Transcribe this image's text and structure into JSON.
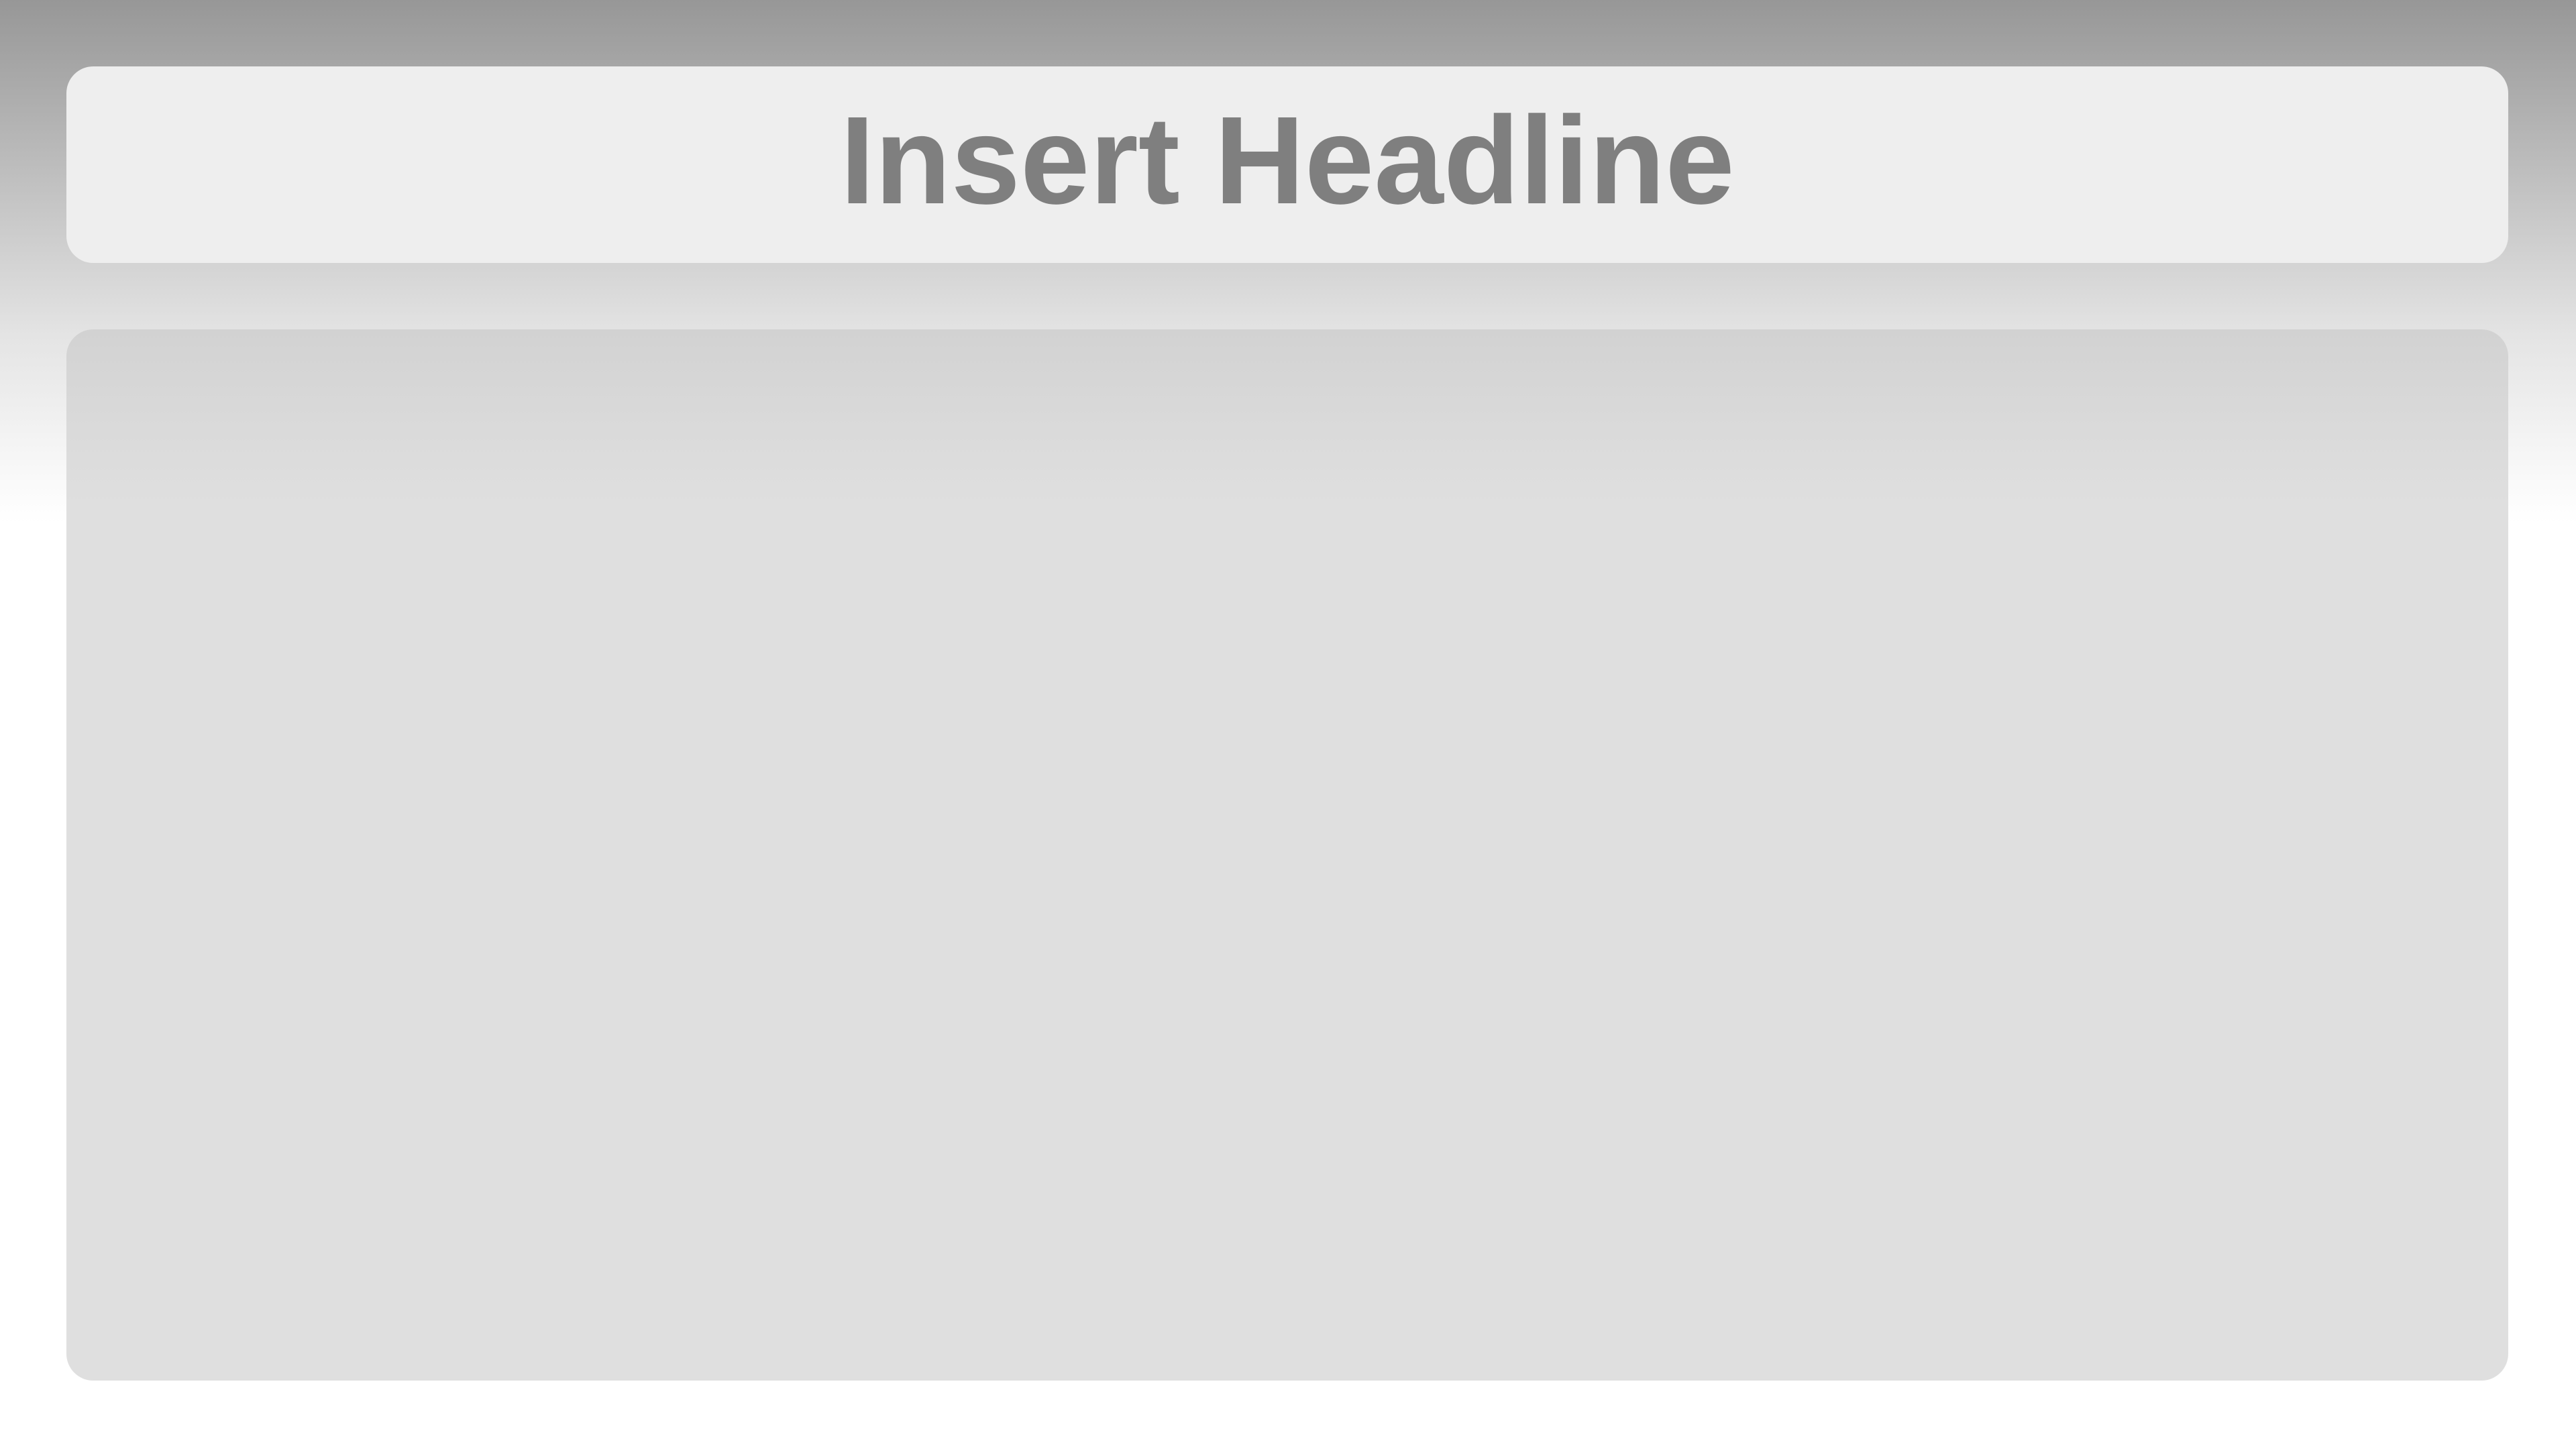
{
  "slide": {
    "headline": "Insert Headline"
  },
  "colors": {
    "headline_text": "#7f7f7f",
    "headline_box": "#eeeeee",
    "content_box": "#dfdfdf",
    "background_top": "#979797",
    "background_bottom": "#ffffff"
  }
}
